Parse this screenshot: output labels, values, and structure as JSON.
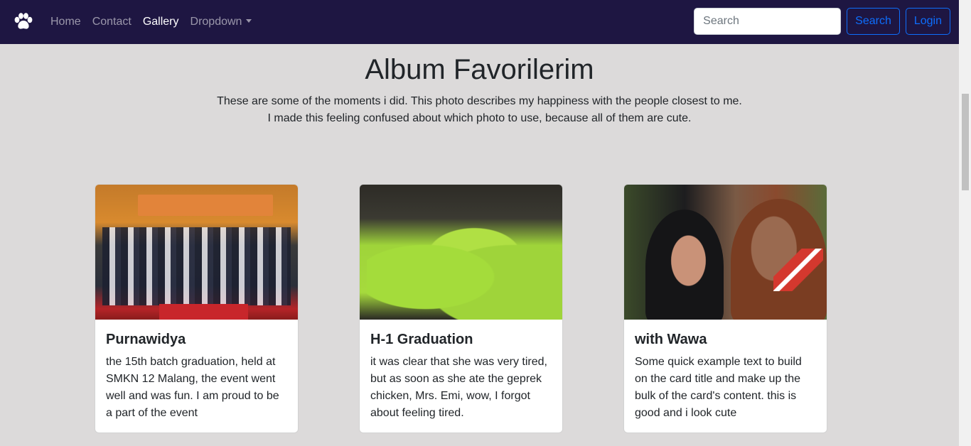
{
  "navbar": {
    "brand_icon": "paw-icon",
    "links": [
      {
        "label": "Home",
        "active": false
      },
      {
        "label": "Contact",
        "active": false
      },
      {
        "label": "Gallery",
        "active": true
      },
      {
        "label": "Dropdown",
        "active": false,
        "dropdown": true
      }
    ],
    "search_placeholder": "Search",
    "search_button": "Search",
    "login_button": "Login"
  },
  "header": {
    "title": "Album Favorilerim",
    "lead_line1": "These are some of the moments i did. This photo describes my happiness with the people closest to me.",
    "lead_line2": "I made this feeling confused about which photo to use, because all of them are cute."
  },
  "cards": [
    {
      "title": "Purnawidya",
      "text": "the 15th batch graduation, held at SMKN 12 Malang, the event went well and was fun. I am proud to be a part of the event"
    },
    {
      "title": "H-1 Graduation",
      "text": "it was clear that she was very tired, but as soon as she ate the geprek chicken, Mrs. Emi, wow, I forgot about feeling tired."
    },
    {
      "title": "with Wawa",
      "text": "Some quick example text to build on the card title and make up the bulk of the card's content. this is good and i look cute"
    }
  ],
  "colors": {
    "navbar_bg": "#1e1642",
    "page_bg": "#dcdada",
    "accent": "#0d6efd"
  }
}
